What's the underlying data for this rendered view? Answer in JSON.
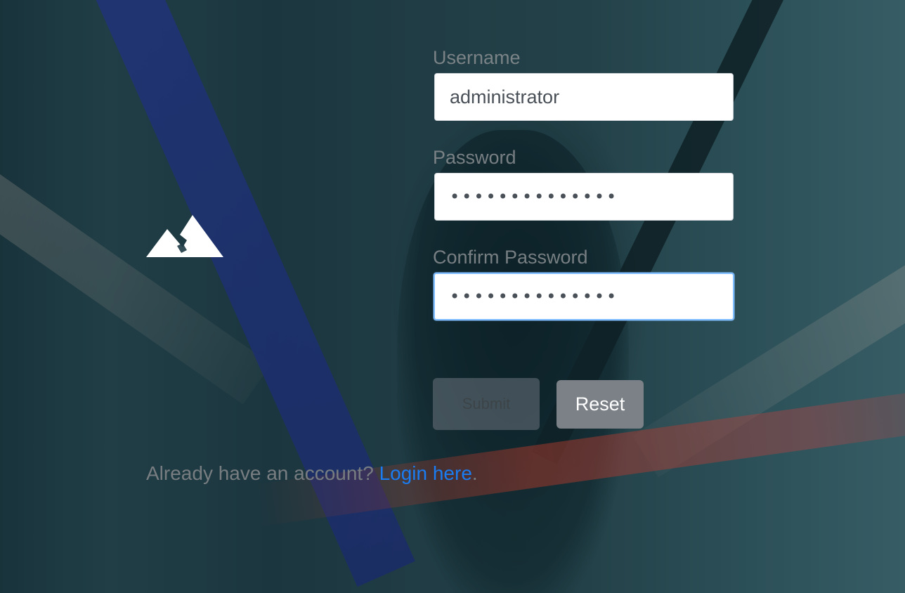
{
  "colors": {
    "link": "#1a7cf0",
    "label": "#8a8f92",
    "input_bg": "#ffffff",
    "focus_border": "#80bdff",
    "reset_bg": "#7b8186"
  },
  "background": {
    "description_icon": "mountain-logo-icon"
  },
  "form": {
    "username": {
      "label": "Username",
      "value": "administrator"
    },
    "password": {
      "label": "Password",
      "value": "••••••••••••••"
    },
    "confirm_password": {
      "label": "Confirm Password",
      "value": "••••••••••••••"
    },
    "submit_label": "Submit",
    "reset_label": "Reset"
  },
  "footer": {
    "prompt": "Already have an account? ",
    "link_label": "Login here",
    "suffix": "."
  }
}
